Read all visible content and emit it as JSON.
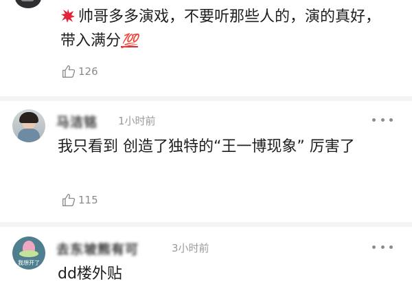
{
  "comments": [
    {
      "text": "帅哥多多演戏，不要听那些人的，演的真好，带入满分",
      "emoji_lead": "angry-face-emoji",
      "emoji_tail": "💯",
      "likes": "126"
    },
    {
      "username": "马洁铭",
      "time": "1小时前",
      "text": "我只看到  创造了独特的“王一博现象”  厉害了",
      "likes": "115"
    },
    {
      "username": "去东坡熊有可",
      "time": "3小时前",
      "text": "dd楼外贴",
      "avatar_caption": "我想开了"
    }
  ],
  "colors": {
    "accent_red": "#e0243a",
    "meta_gray": "#9a9a9a",
    "divider": "#f4f4f4"
  },
  "icons": [
    "thumbs-up-icon",
    "more-dots-icon"
  ]
}
